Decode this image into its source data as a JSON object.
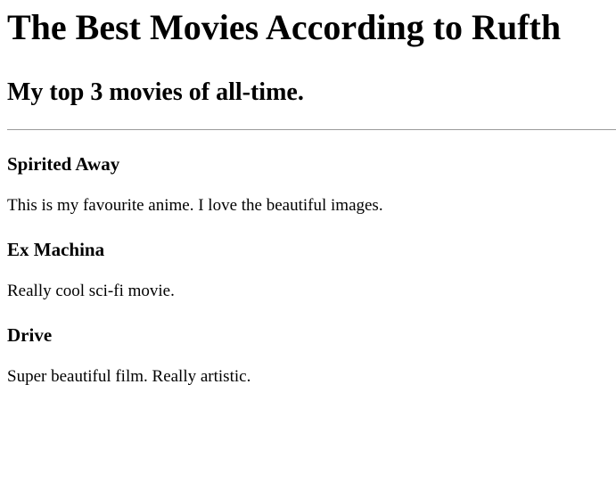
{
  "page": {
    "title": "The Best Movies According to Rufth",
    "subtitle": "My top 3 movies of all-time."
  },
  "movies": [
    {
      "name": "Spirited Away",
      "description": "This is my favourite anime. I love the beautiful images."
    },
    {
      "name": "Ex Machina",
      "description": "Really cool sci-fi movie."
    },
    {
      "name": "Drive",
      "description": "Super beautiful film. Really artistic."
    }
  ]
}
